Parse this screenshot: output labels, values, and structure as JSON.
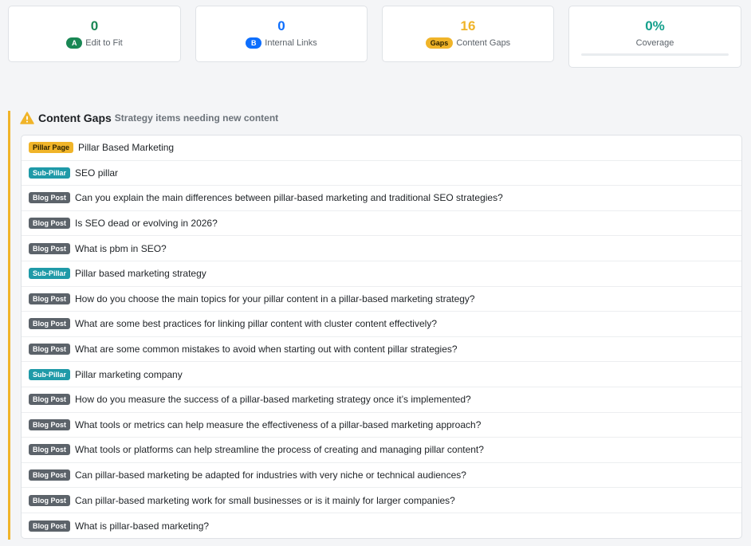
{
  "stats": [
    {
      "value": "0",
      "badge": "A",
      "label": "Edit to Fit",
      "color": "#198754",
      "badge_color": "#198754"
    },
    {
      "value": "0",
      "badge": "B",
      "label": "Internal Links",
      "color": "#0d6efd",
      "badge_color": "#0d6efd"
    },
    {
      "value": "16",
      "badge": "Gaps",
      "label": "Content Gaps",
      "color": "#f0b429",
      "badge_color": "#f0b429"
    },
    {
      "value": "0%",
      "label": "Coverage",
      "color": "#14a08c",
      "progress": 0
    }
  ],
  "section": {
    "title": "Content Gaps",
    "subtitle": "Strategy items needing new content"
  },
  "gaps": [
    {
      "type": "Pillar Page",
      "kind": "pillar",
      "title": "Pillar Based Marketing"
    },
    {
      "type": "Sub-Pillar",
      "kind": "sub",
      "title": "SEO pillar"
    },
    {
      "type": "Blog Post",
      "kind": "blog",
      "title": "Can you explain the main differences between pillar-based marketing and traditional SEO strategies?"
    },
    {
      "type": "Blog Post",
      "kind": "blog",
      "title": "Is SEO dead or evolving in 2026?"
    },
    {
      "type": "Blog Post",
      "kind": "blog",
      "title": "What is pbm in SEO?"
    },
    {
      "type": "Sub-Pillar",
      "kind": "sub",
      "title": "Pillar based marketing strategy"
    },
    {
      "type": "Blog Post",
      "kind": "blog",
      "title": "How do you choose the main topics for your pillar content in a pillar-based marketing strategy?"
    },
    {
      "type": "Blog Post",
      "kind": "blog",
      "title": "What are some best practices for linking pillar content with cluster content effectively?"
    },
    {
      "type": "Blog Post",
      "kind": "blog",
      "title": "What are some common mistakes to avoid when starting out with content pillar strategies?"
    },
    {
      "type": "Sub-Pillar",
      "kind": "sub",
      "title": "Pillar marketing company"
    },
    {
      "type": "Blog Post",
      "kind": "blog",
      "title": "How do you measure the success of a pillar-based marketing strategy once it’s implemented?"
    },
    {
      "type": "Blog Post",
      "kind": "blog",
      "title": "What tools or metrics can help measure the effectiveness of a pillar-based marketing approach?"
    },
    {
      "type": "Blog Post",
      "kind": "blog",
      "title": "What tools or platforms can help streamline the process of creating and managing pillar content?"
    },
    {
      "type": "Blog Post",
      "kind": "blog",
      "title": "Can pillar-based marketing be adapted for industries with very niche or technical audiences?"
    },
    {
      "type": "Blog Post",
      "kind": "blog",
      "title": "Can pillar-based marketing work for small businesses or is it mainly for larger companies?"
    },
    {
      "type": "Blog Post",
      "kind": "blog",
      "title": "What is pillar-based marketing?"
    }
  ],
  "icons": {
    "section": "warning-icon"
  }
}
